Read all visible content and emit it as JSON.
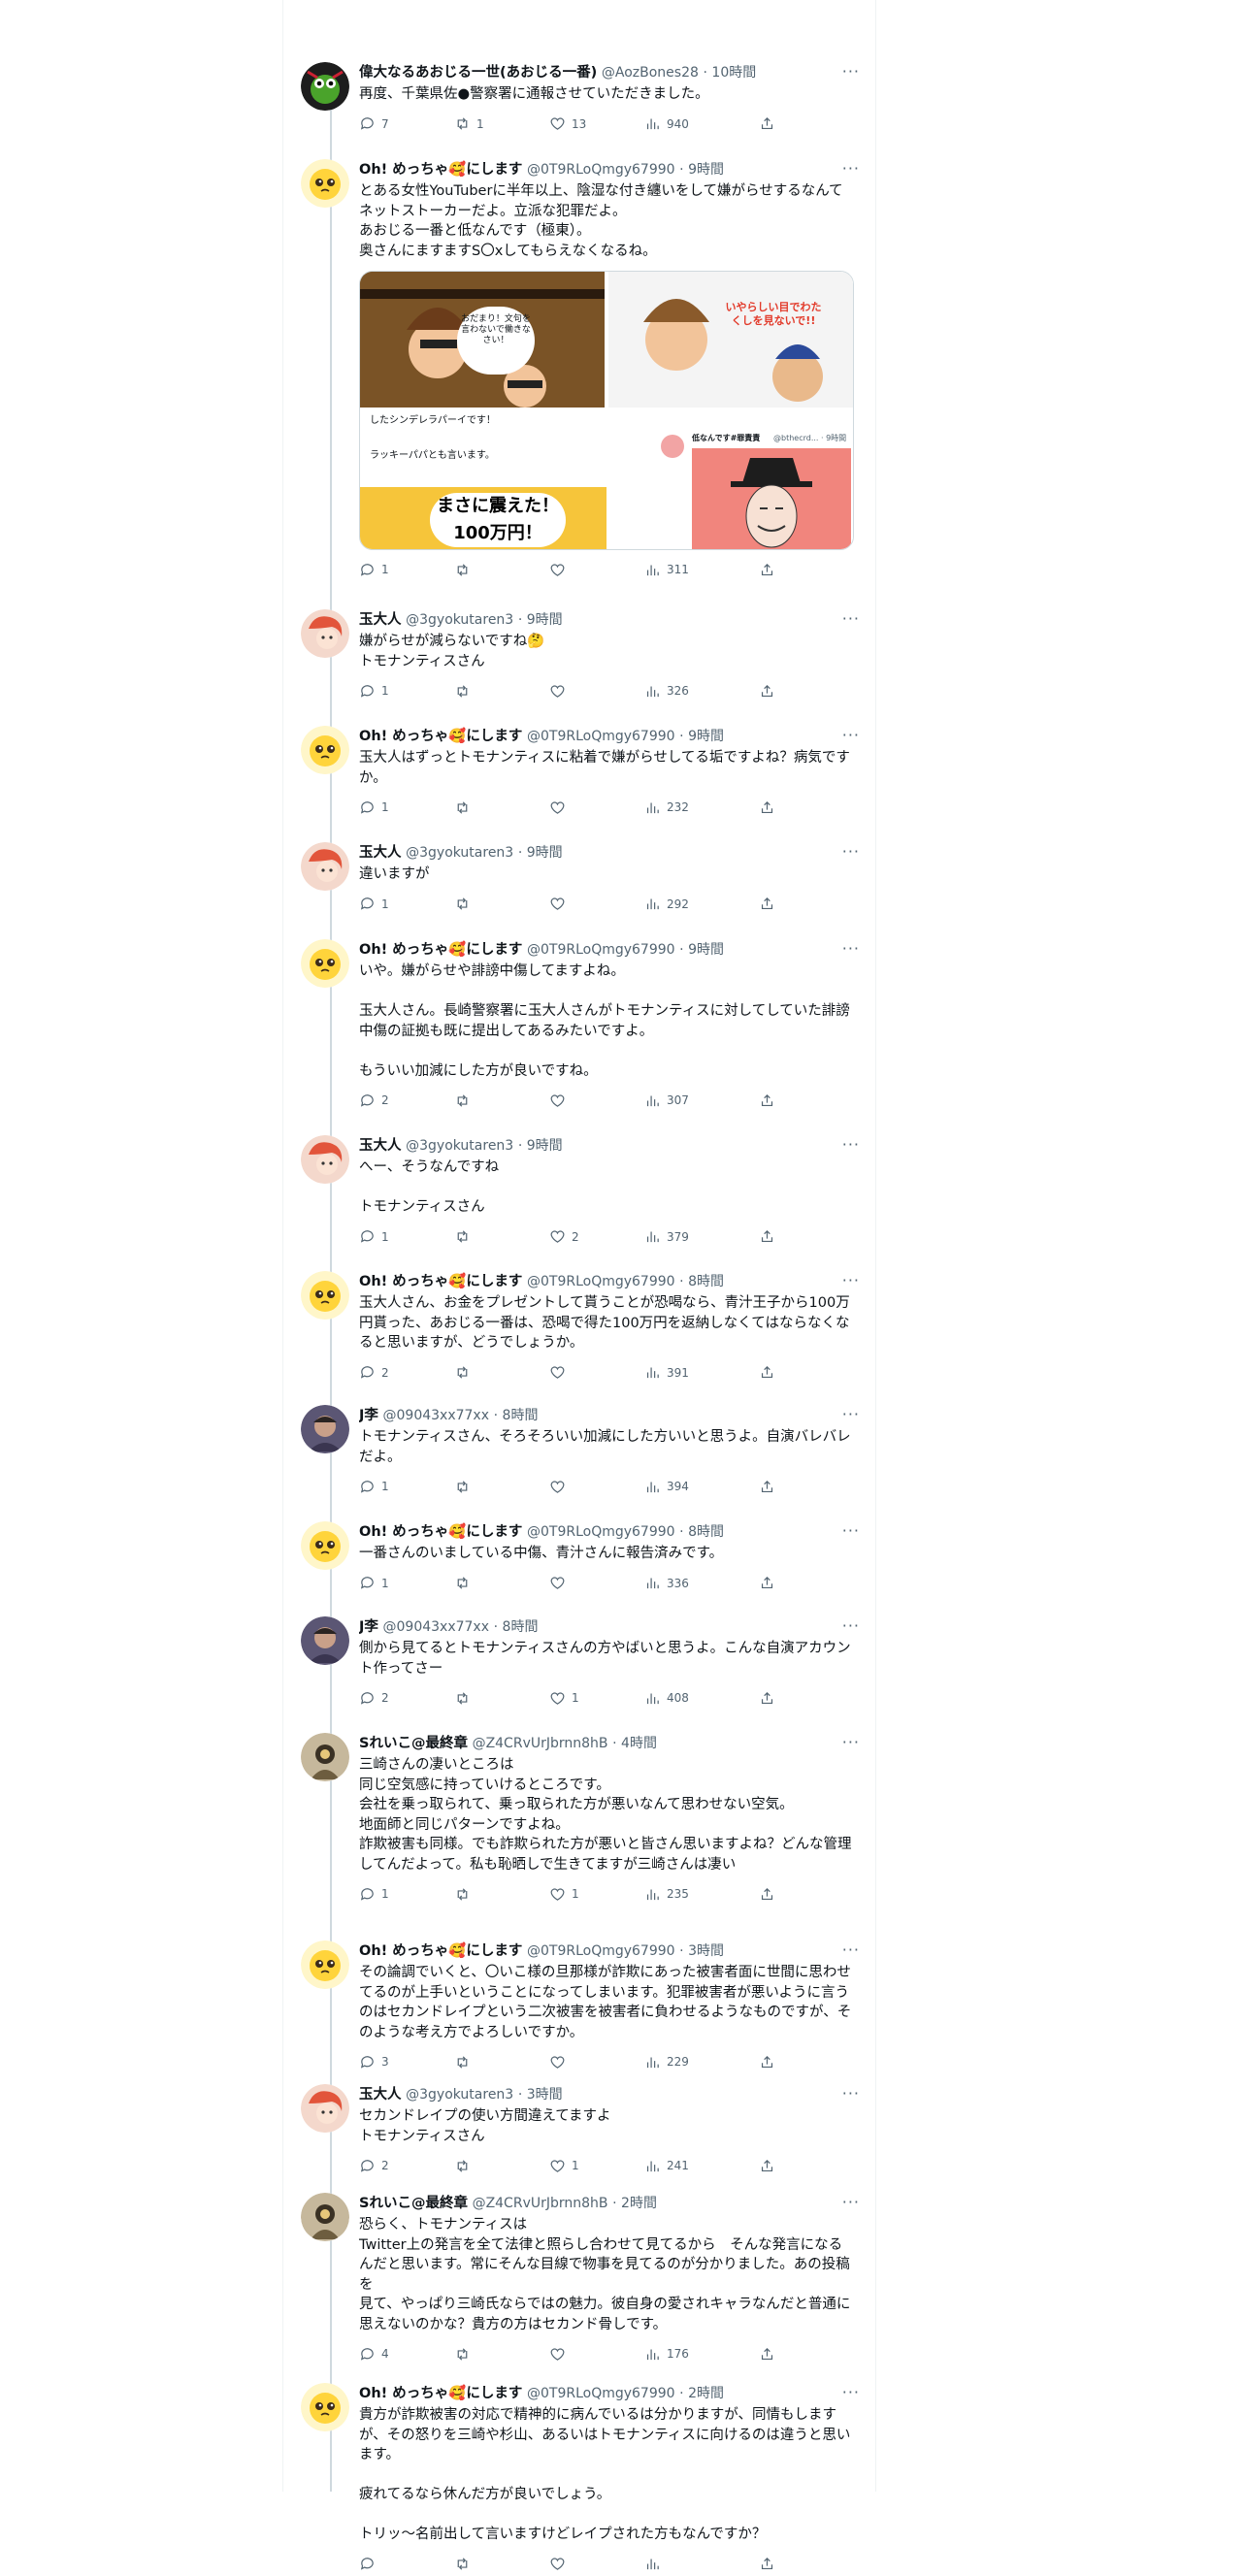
{
  "tweets": [
    {
      "name": "偉大なるあおじる一世(あおじる一番)",
      "handle": "@AozBones28",
      "time": "10時間",
      "text": "再度、千葉県佐●警察署に通報させていただきました。",
      "replies": "7",
      "retweets": "1",
      "likes": "13",
      "views": "940"
    },
    {
      "name": "Oh! めっちゃ🥰にします",
      "handle": "@0T9RLoQmgy67990",
      "time": "9時間",
      "text": "とある女性YouTuberに半年以上、陰湿な付き纏いをして嫌がらせするなんてネットストーカーだよ。立派な犯罪だよ。\nあおじる一番と低なんです（極東）。\n奥さんにますますS〇xしてもらえなくなるね。",
      "replies": "1",
      "retweets": "",
      "likes": "",
      "views": "311"
    },
    {
      "name": "玉大人",
      "handle": "@3gyokutaren3",
      "time": "9時間",
      "text": "嫌がらせが減らないですね🤔\nトモナンティスさん",
      "replies": "1",
      "retweets": "",
      "likes": "",
      "views": "326"
    },
    {
      "name": "Oh! めっちゃ🥰にします",
      "handle": "@0T9RLoQmgy67990",
      "time": "9時間",
      "text": "玉大人はずっとトモナンティスに粘着で嫌がらせしてる垢ですよね？病気ですか。",
      "replies": "1",
      "retweets": "",
      "likes": "",
      "views": "232"
    },
    {
      "name": "玉大人",
      "handle": "@3gyokutaren3",
      "time": "9時間",
      "text": "違いますが",
      "replies": "1",
      "retweets": "",
      "likes": "",
      "views": "292"
    },
    {
      "name": "Oh! めっちゃ🥰にします",
      "handle": "@0T9RLoQmgy67990",
      "time": "9時間",
      "text": "いや。嫌がらせや誹謗中傷してますよね。\n\n玉大人さん。長崎警察署に玉大人さんがトモナンティスに対してしていた誹謗中傷の証拠も既に提出してあるみたいですよ。\n\nもういい加減にした方が良いですね。",
      "replies": "2",
      "retweets": "",
      "likes": "",
      "views": "307"
    },
    {
      "name": "玉大人",
      "handle": "@3gyokutaren3",
      "time": "9時間",
      "text": "へー、そうなんですね\n\nトモナンティスさん",
      "replies": "1",
      "retweets": "",
      "likes": "2",
      "views": "379"
    },
    {
      "name": "Oh! めっちゃ🥰にします",
      "handle": "@0T9RLoQmgy67990",
      "time": "8時間",
      "text": "玉大人さん、お金をプレゼントして貰うことが恐喝なら、青汁王子から100万円貰った、あおじる一番は、恐喝で得た100万円を返納しなくてはならなくなると思いますが、どうでしょうか。",
      "replies": "2",
      "retweets": "",
      "likes": "",
      "views": "391"
    },
    {
      "name": "J李",
      "handle": "@09043xx77xx",
      "time": "8時間",
      "text": "トモナンティスさん、そろそろいい加減にした方いいと思うよ。自演バレバレだよ。",
      "replies": "1",
      "retweets": "",
      "likes": "",
      "views": "394"
    },
    {
      "name": "Oh! めっちゃ🥰にします",
      "handle": "@0T9RLoQmgy67990",
      "time": "8時間",
      "text": "一番さんのいましている中傷、青汁さんに報告済みです。",
      "replies": "1",
      "retweets": "",
      "likes": "",
      "views": "336"
    },
    {
      "name": "J李",
      "handle": "@09043xx77xx",
      "time": "8時間",
      "text": "側から見てるとトモナンティスさんの方やばいと思うよ。こんな自演アカウント作ってさー",
      "replies": "2",
      "retweets": "",
      "likes": "1",
      "views": "408"
    },
    {
      "name": "Sれいこ@最終章",
      "handle": "@Z4CRvUrJbrnn8hB",
      "time": "4時間",
      "text": "三崎さんの凄いところは\n同じ空気感に持っていけるところです。\n会社を乗っ取られて、乗っ取られた方が悪いなんて思わせない空気。\n地面師と同じパターンですよね。\n詐欺被害も同様。でも詐欺られた方が悪いと皆さん思いますよね？どんな管理してんだよって。私も恥晒しで生きてますが三崎さんは凄い",
      "replies": "1",
      "retweets": "",
      "likes": "1",
      "views": "235"
    },
    {
      "name": "Oh! めっちゃ🥰にします",
      "handle": "@0T9RLoQmgy67990",
      "time": "3時間",
      "text": "その論調でいくと、〇いこ様の旦那様が詐欺にあった被害者面に世間に思わせてるのが上手いということになってしまいます。犯罪被害者が悪いように言うのはセカンドレイプという二次被害を被害者に負わせるようなものですが、そのような考え方でよろしいですか。",
      "replies": "3",
      "retweets": "",
      "likes": "",
      "views": "229"
    },
    {
      "name": "玉大人",
      "handle": "@3gyokutaren3",
      "time": "3時間",
      "text": "セカンドレイプの使い方間違えてますよ\nトモナンティスさん",
      "replies": "2",
      "retweets": "",
      "likes": "1",
      "views": "241"
    },
    {
      "name": "Sれいこ@最終章",
      "handle": "@Z4CRvUrJbrnn8hB",
      "time": "2時間",
      "text": "恐らく、トモナンティスは\nTwitter上の発言を全て法律と照らし合わせて見てるから　そんな発言になるんだと思います。常にそんな目線で物事を見てるのが分かりました。あの投稿を\n見て、やっぱり三崎氏ならではの魅力。彼自身の愛されキャラなんだと普通に思えないのかな？貴方の方はセカンド骨しです。",
      "replies": "4",
      "retweets": "",
      "likes": "",
      "views": "176"
    },
    {
      "name": "Oh! めっちゃ🥰にします",
      "handle": "@0T9RLoQmgy67990",
      "time": "2時間",
      "text": "貴方が詐欺被害の対応で精神的に病んでいるは分かりますが、同情もしますが、その怒りを三崎や杉山、あるいはトモナンティスに向けるのは違うと思います。\n\n疲れてるなら休んだ方が良いでしょう。\n\nトリッ〜名前出して言いますけどレイプされた方もなんですか？",
      "replies": "",
      "retweets": "",
      "likes": "",
      "views": ""
    }
  ],
  "media": {
    "bubble1": "おだまり！文句を言わないで働きなさい！",
    "bubble2": "いやらしい目でわたくしを見ないで!!",
    "caption1": "したシンデレラパーイです！",
    "caption2": "ラッキーパパとも言います。",
    "headline": "まさに震えた！100万円！",
    "quote_name": "低なんです#罪責責",
    "quote_meta": "@bthecrd... · 9時間"
  }
}
